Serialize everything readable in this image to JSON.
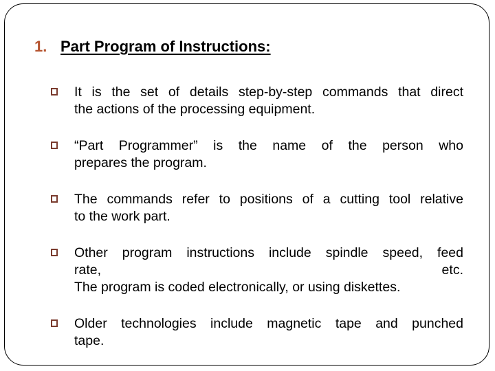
{
  "slide": {
    "heading": {
      "number": "1.",
      "text": "Part Program of Instructions:"
    },
    "bullets": [
      {
        "icon": "square-bullet-icon",
        "lines": [
          "It is the set of details step-by-step commands that direct",
          "the actions of the processing equipment."
        ]
      },
      {
        "icon": "square-bullet-icon",
        "lines": [
          "“Part Programmer” is the name of the person who",
          "prepares the program."
        ]
      },
      {
        "icon": "square-bullet-icon",
        "lines": [
          "The commands refer to positions of a cutting tool relative",
          "to the work part."
        ]
      },
      {
        "icon": "square-bullet-icon",
        "lines": [
          "Other program instructions include spindle speed, feed",
          "rate, etc.",
          "The program is coded electronically, or using diskettes."
        ]
      },
      {
        "icon": "square-bullet-icon",
        "lines": [
          "Older technologies include magnetic tape and punched",
          "tape."
        ]
      }
    ],
    "colors": {
      "number": "#b5532e",
      "bullet": "#7a3b2e",
      "text": "#000000"
    }
  }
}
